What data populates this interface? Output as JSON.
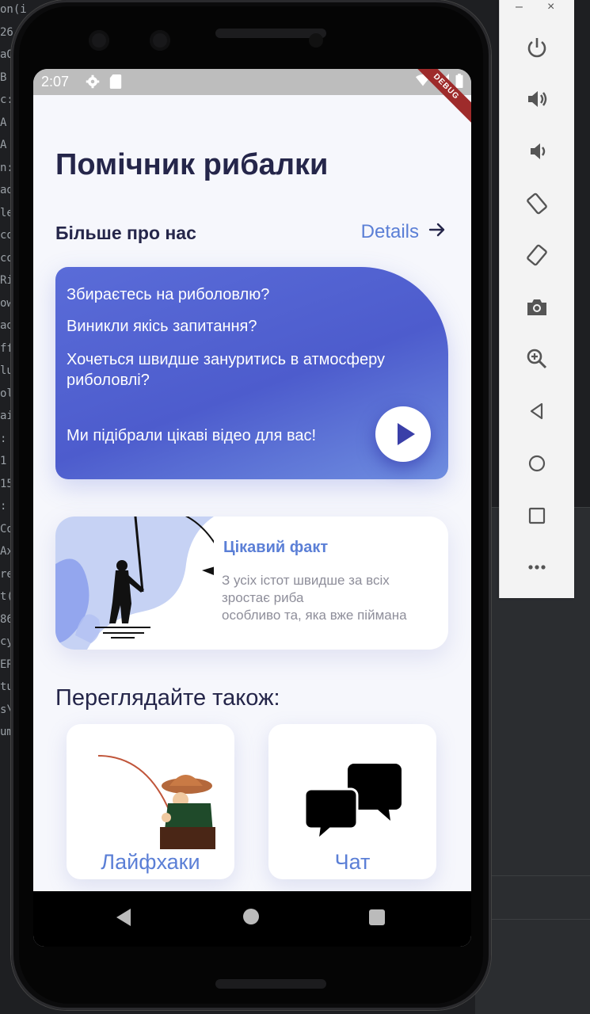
{
  "status_bar": {
    "time": "2:07",
    "debug_label": "DEBUG"
  },
  "app": {
    "title": "Помічник рибалки",
    "about_label": "Більше про нас",
    "details_link": "Details",
    "hero_lines": [
      "Збираєтесь на риболовлю?",
      "Виникли якісь запитання?",
      "Хочеться швидше зануритись в атмосферу риболовлі?",
      "Ми підібрали цікаві відео для вас!"
    ],
    "fact_card": {
      "title": "Цікавий факт",
      "text_line1": "З усіх істот швидше за всіх зростає риба",
      "text_line2": "особливо та, яка вже піймана"
    },
    "see_also_heading": "Переглядайте також:",
    "tiles": [
      {
        "label": "Лайфхаки"
      },
      {
        "label": "Чат"
      }
    ]
  },
  "ide": {
    "code_fragments": [
      "on(i",
      "26",
      "aQ",
      "B",
      "c:",
      "A",
      "A",
      "n:",
      "ad",
      "le",
      "co",
      "co",
      "Ri",
      "ow",
      "ad",
      "ff",
      "lu",
      "ol",
      "ai",
      ":",
      "1",
      "15",
      ":",
      "Co",
      "Ax",
      "re",
      "t(",
      "86",
      "cy",
      "ER",
      "tu",
      "s\\a",
      "ument(haven failed"
    ]
  },
  "emulator_toolbar": {
    "minimize": "–",
    "close": "×",
    "icons": [
      "power-icon",
      "volume-up-icon",
      "volume-down-icon",
      "rotate-left-icon",
      "rotate-right-icon",
      "screenshot-icon",
      "zoom-icon",
      "back-icon",
      "home-icon",
      "overview-icon",
      "more-icon"
    ]
  },
  "colors": {
    "accent": "#5b7fd6",
    "hero_gradient_start": "#5a6cd8",
    "title": "#25264a",
    "debug_ribbon": "#9e2b2b"
  }
}
